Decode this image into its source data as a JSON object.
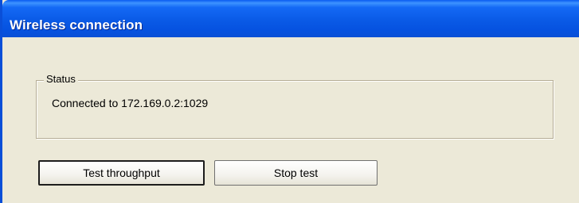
{
  "window": {
    "title": "Wireless connection"
  },
  "status_group": {
    "legend": "Status",
    "text": "Connected to 172.169.0.2:1029"
  },
  "buttons": {
    "test_throughput": "Test throughput",
    "stop_test": "Stop test"
  },
  "colors": {
    "titlebar": "#0a5ae6",
    "dialog_background": "#ece9d8",
    "group_border": "#b5ac94"
  }
}
